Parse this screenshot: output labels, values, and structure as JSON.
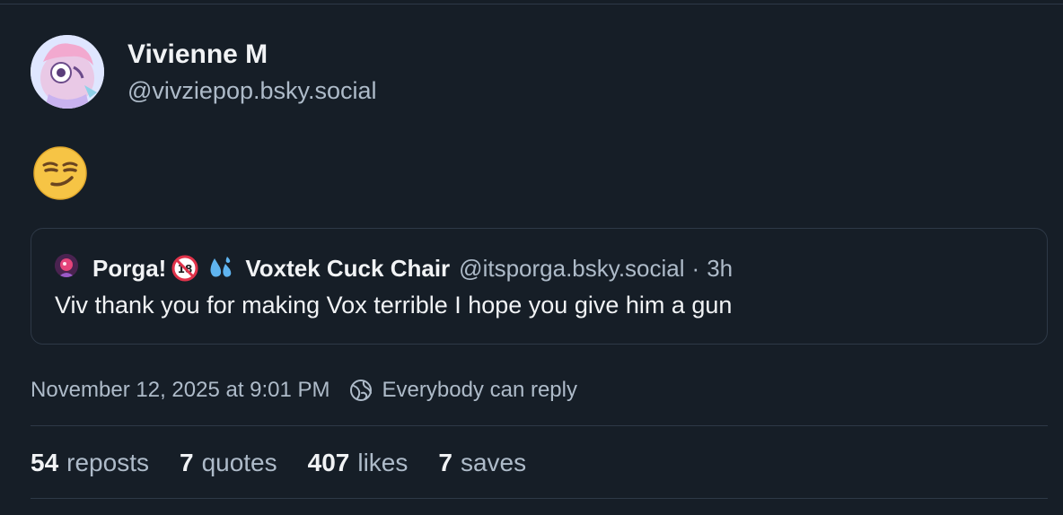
{
  "author": {
    "name": "Vivienne M",
    "handle": "@vivziepop.bsky.social"
  },
  "post": {
    "emoji": "smirking-face"
  },
  "quote": {
    "name": "Porga!",
    "badge_emoji": "no-one-under-eighteen",
    "badge_emoji2": "sweat-droplets",
    "name2": "Voxtek Cuck Chair",
    "handle": "@itsporga.bsky.social",
    "separator": "·",
    "time": "3h",
    "text": "Viv thank you for making Vox terrible I hope you give him a gun"
  },
  "meta": {
    "timestamp": "November 12, 2025 at 9:01 PM",
    "reply_setting": "Everybody can reply",
    "reply_icon": "globe-icon"
  },
  "stats": [
    {
      "count": "54",
      "label": "reposts"
    },
    {
      "count": "7",
      "label": "quotes"
    },
    {
      "count": "407",
      "label": "likes"
    },
    {
      "count": "7",
      "label": "saves"
    }
  ],
  "colors": {
    "background": "#161e27",
    "border": "#2e3947",
    "text": "#f1f3f5",
    "muted": "#aebbc9"
  }
}
